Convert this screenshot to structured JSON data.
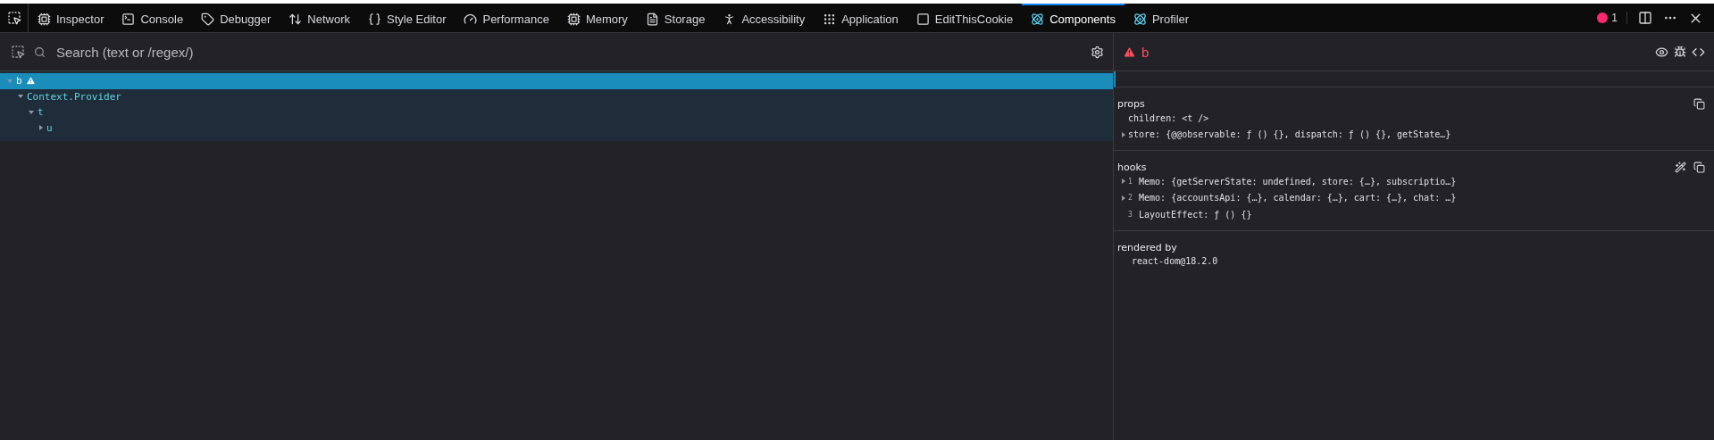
{
  "toolbar": {
    "tabs": [
      {
        "label": "Inspector",
        "selected": false
      },
      {
        "label": "Console",
        "selected": false
      },
      {
        "label": "Debugger",
        "selected": false
      },
      {
        "label": "Network",
        "selected": false
      },
      {
        "label": "Style Editor",
        "selected": false
      },
      {
        "label": "Performance",
        "selected": false
      },
      {
        "label": "Memory",
        "selected": false
      },
      {
        "label": "Storage",
        "selected": false
      },
      {
        "label": "Accessibility",
        "selected": false
      },
      {
        "label": "Application",
        "selected": false
      },
      {
        "label": "EditThisCookie",
        "selected": false
      },
      {
        "label": "Components",
        "selected": true
      },
      {
        "label": "Profiler",
        "selected": false
      }
    ],
    "error_count": "1"
  },
  "search": {
    "placeholder": "Search (text or /regex/)"
  },
  "tree": [
    {
      "name": "b",
      "warning": true,
      "selected": true,
      "expanded": true,
      "children": [
        {
          "name": "Context.Provider",
          "warning": false,
          "selected": false,
          "expanded": true,
          "children": [
            {
              "name": "t",
              "warning": false,
              "selected": false,
              "expanded": true,
              "children": [
                {
                  "name": "u",
                  "warning": false,
                  "selected": false,
                  "expanded": false
                }
              ]
            }
          ]
        }
      ]
    }
  ],
  "inspector": {
    "component": "b",
    "warning": true,
    "props": {
      "title": "props",
      "items": [
        {
          "key": "children:",
          "value": "<t />",
          "expandable": false
        },
        {
          "key": "store:",
          "value": "{@@observable: ƒ () {}, dispatch: ƒ () {}, getState…}",
          "expandable": true
        }
      ]
    },
    "hooks": {
      "title": "hooks",
      "items": [
        {
          "index": "1",
          "key": "Memo:",
          "value": "{getServerState: undefined, store: {…}, subscriptio…}",
          "expandable": true
        },
        {
          "index": "2",
          "key": "Memo:",
          "value": "{accountsApi: {…}, calendar: {…}, cart: {…}, chat: …}",
          "expandable": true
        },
        {
          "index": "3",
          "key": "LayoutEffect:",
          "value": "ƒ () {}",
          "expandable": false
        }
      ]
    },
    "rendered_by": {
      "title": "rendered by",
      "items": [
        "react-dom@18.2.0"
      ]
    }
  }
}
